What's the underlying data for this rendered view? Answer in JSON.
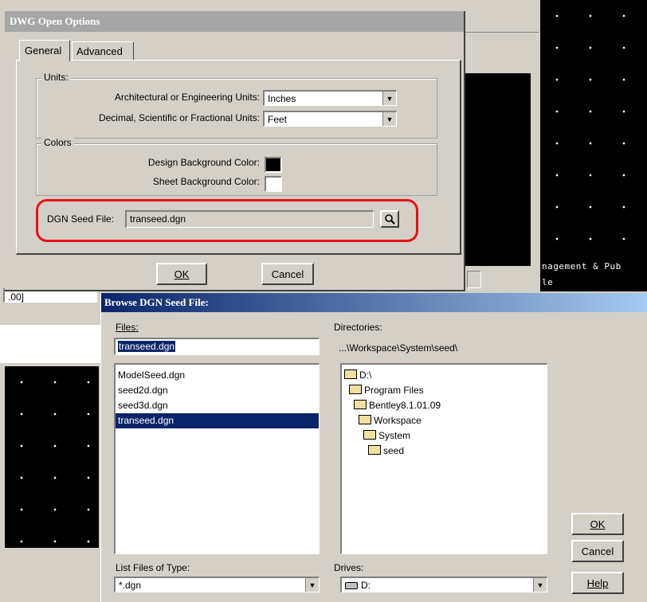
{
  "dwg_dialog": {
    "title": "DWG Open Options",
    "tabs": [
      "General",
      "Advanced"
    ],
    "units": {
      "legend": "Units:",
      "arch_label": "Architectural or Engineering Units:",
      "arch_value": "Inches",
      "dec_label": "Decimal, Scientific or Fractional Units:",
      "dec_value": "Feet"
    },
    "colors": {
      "legend": "Colors",
      "design_label": "Design Background Color:",
      "sheet_label": "Sheet Background Color:",
      "design_color": "#000000",
      "sheet_color": "#ffffff"
    },
    "seed": {
      "label": "DGN Seed File:",
      "value": "transeed.dgn"
    },
    "ok_label": "OK",
    "cancel_label": "Cancel"
  },
  "background": {
    "status_line1": "nagement & Pub",
    "status_line2": "le",
    "left_combo_text": ".00]"
  },
  "browse_dialog": {
    "title": "Browse DGN Seed File:",
    "files_label": "Files:",
    "file_input_value": "transeed.dgn",
    "files": [
      "ModelSeed.dgn",
      "seed2d.dgn",
      "seed3d.dgn",
      "transeed.dgn"
    ],
    "selected_file": 3,
    "directories_label": "Directories:",
    "current_dir": "...\\Workspace\\System\\seed\\",
    "dirs": [
      "D:\\",
      "Program Files",
      "Bentley8.1.01.09",
      "Workspace",
      "System",
      "seed"
    ],
    "list_type_label": "List Files of Type:",
    "list_type_value": "*.dgn",
    "drives_label": "Drives:",
    "drive_value": "D:",
    "ok_label": "OK",
    "cancel_label": "Cancel",
    "help_label": "Help"
  }
}
